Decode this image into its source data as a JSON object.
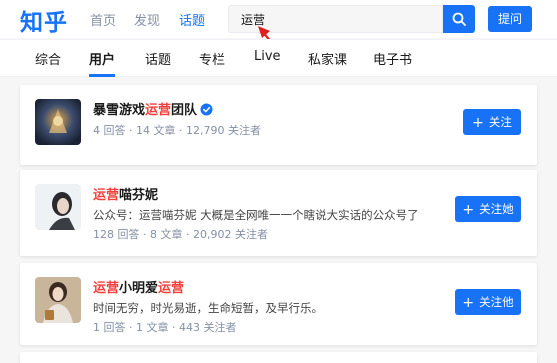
{
  "header": {
    "logo": "知乎",
    "nav": [
      "首页",
      "发现",
      "话题"
    ],
    "search_value": "运营",
    "ask_label": "提问",
    "brand_color": "#1772f6"
  },
  "tabs": [
    "综合",
    "用户",
    "话题",
    "专栏",
    "Live",
    "私家课",
    "电子书"
  ],
  "active_tab": "用户",
  "results": [
    {
      "name_parts": [
        "暴雪游戏",
        "运营",
        "团队"
      ],
      "verified": true,
      "stats": "4 回答 · 14 文章 · 12,790 关注者",
      "follow_label": "关注"
    },
    {
      "name_parts": [
        "运营",
        "喵芬妮"
      ],
      "description": "公众号：运营喵芬妮 大概是全网唯一一个瞎说大实话的公众号了",
      "stats": "128 回答 · 8 文章 · 20,902 关注者",
      "follow_label": "关注她"
    },
    {
      "name_parts": [
        "运营",
        "小明爱",
        "运营"
      ],
      "description": "时间无穷，时光易逝，生命短暂，及早行乐。",
      "stats": "1 回答 · 1 文章 · 443 关注者",
      "follow_label": "关注他"
    }
  ]
}
